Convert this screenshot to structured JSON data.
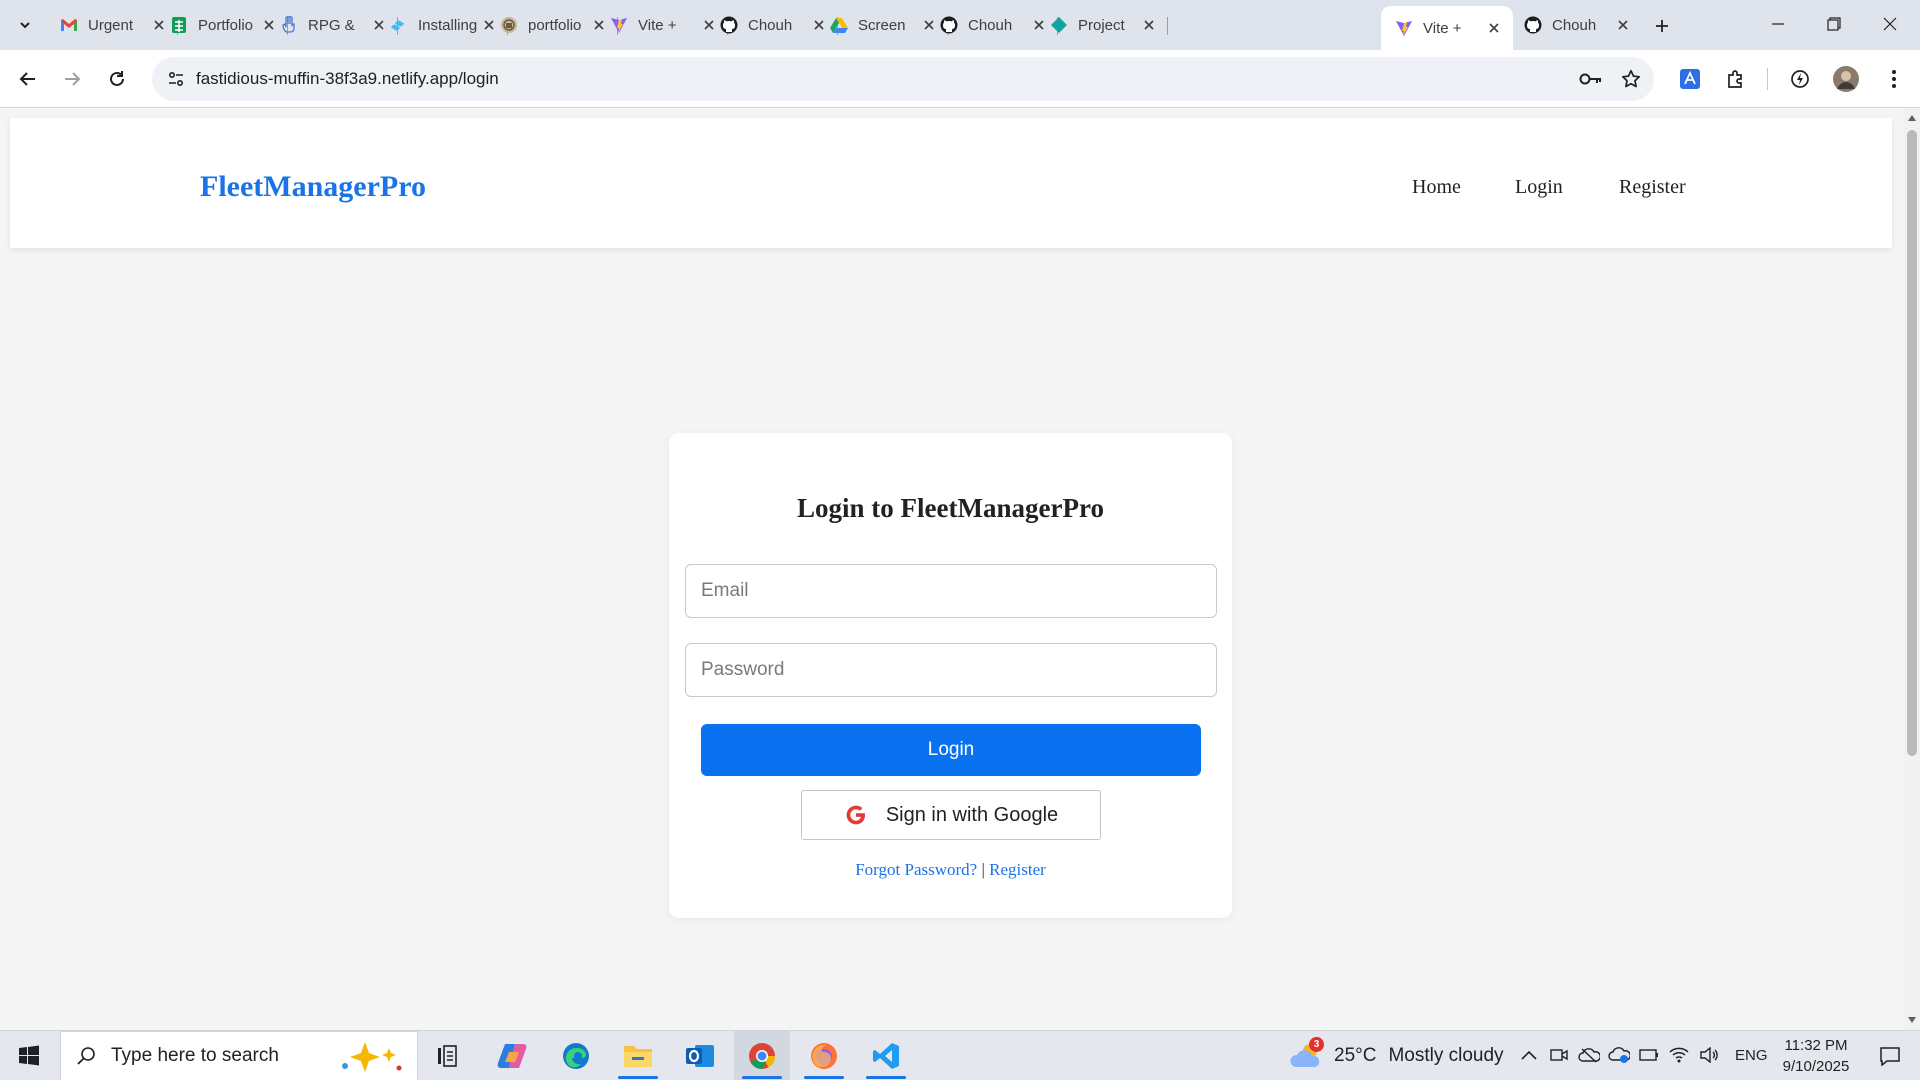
{
  "browser": {
    "tabs": [
      {
        "title": "Urgent",
        "icon": "gmail-icon",
        "active": false
      },
      {
        "title": "Portfolio",
        "icon": "sheets-icon",
        "active": false
      },
      {
        "title": "RPG &",
        "icon": "hand-icon",
        "active": false
      },
      {
        "title": "Installing",
        "icon": "tailwind-icon",
        "active": false
      },
      {
        "title": "portfolio",
        "icon": "site-icon",
        "active": false
      },
      {
        "title": "Vite +",
        "icon": "vite-icon",
        "active": false
      },
      {
        "title": "Chouh",
        "icon": "github-icon",
        "active": false
      },
      {
        "title": "Screen",
        "icon": "drive-icon",
        "active": false
      },
      {
        "title": "Chouh",
        "icon": "github-icon",
        "active": false
      },
      {
        "title": "Project",
        "icon": "diamond-icon",
        "active": false
      },
      {
        "title": "Vite +",
        "icon": "vite-icon",
        "active": true
      },
      {
        "title": "Chouh",
        "icon": "github-icon",
        "active": false
      }
    ],
    "url": "fastidious-muffin-38f3a9.netlify.app/login"
  },
  "site": {
    "brand": "FleetManagerPro",
    "nav": {
      "home": "Home",
      "login": "Login",
      "register": "Register"
    }
  },
  "login_card": {
    "title": "Login to FleetManagerPro",
    "email_placeholder": "Email",
    "password_placeholder": "Password",
    "login_button": "Login",
    "google_button": "Sign in with Google",
    "forgot_link": "Forgot Password?",
    "separator": " | ",
    "register_link": "Register"
  },
  "taskbar": {
    "search_placeholder": "Type here to search",
    "weather": {
      "temp": "25°C",
      "condition": "Mostly cloudy",
      "badge": "3"
    },
    "lang": "ENG",
    "time": "11:32 PM",
    "date": "9/10/2025"
  },
  "colors": {
    "accent": "#1a73e8",
    "login_button": "#0a72f0",
    "page_bg": "#f5f5f5"
  }
}
